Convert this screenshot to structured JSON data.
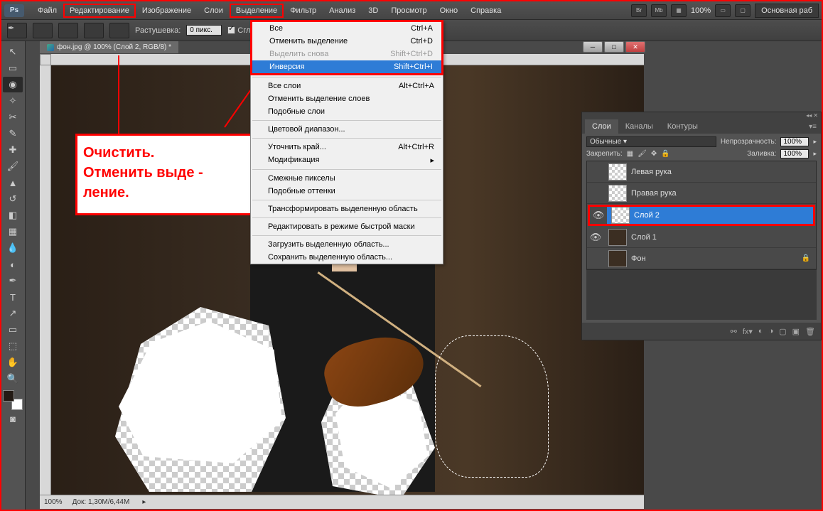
{
  "menubar": {
    "items": [
      "Файл",
      "Редактирование",
      "Изображение",
      "Слои",
      "Выделение",
      "Фильтр",
      "Анализ",
      "3D",
      "Просмотр",
      "Окно",
      "Справка"
    ],
    "zoom": "100%",
    "workspace": "Основная раб"
  },
  "optionsbar": {
    "feather_label": "Растушевка:",
    "feather_value": "0 пикс.",
    "antialias": "Сглаживан"
  },
  "document": {
    "title": "фон.jpg @ 100% (Слой 2, RGB/8) *",
    "status_zoom": "100%",
    "status_doc": "Док: 1,30M/6,44M"
  },
  "annotation": {
    "line1": "Очистить.",
    "line2": "Отменить выде -",
    "line3": "ление."
  },
  "dropdown": {
    "groups": [
      [
        {
          "label": "Все",
          "shortcut": "Ctrl+A",
          "disabled": false
        },
        {
          "label": "Отменить выделение",
          "shortcut": "Ctrl+D",
          "disabled": false
        },
        {
          "label": "Выделить снова",
          "shortcut": "Shift+Ctrl+D",
          "disabled": true
        },
        {
          "label": "Инверсия",
          "shortcut": "Shift+Ctrl+I",
          "disabled": false,
          "selected": true
        }
      ],
      [
        {
          "label": "Все слои",
          "shortcut": "Alt+Ctrl+A",
          "disabled": false
        },
        {
          "label": "Отменить выделение слоев",
          "shortcut": "",
          "disabled": false
        },
        {
          "label": "Подобные слои",
          "shortcut": "",
          "disabled": false
        }
      ],
      [
        {
          "label": "Цветовой диапазон...",
          "shortcut": "",
          "disabled": false
        }
      ],
      [
        {
          "label": "Уточнить край...",
          "shortcut": "Alt+Ctrl+R",
          "disabled": false
        },
        {
          "label": "Модификация",
          "shortcut": "▸",
          "disabled": false
        }
      ],
      [
        {
          "label": "Смежные пикселы",
          "shortcut": "",
          "disabled": false
        },
        {
          "label": "Подобные оттенки",
          "shortcut": "",
          "disabled": false
        }
      ],
      [
        {
          "label": "Трансформировать выделенную область",
          "shortcut": "",
          "disabled": false
        }
      ],
      [
        {
          "label": "Редактировать в режиме быстрой маски",
          "shortcut": "",
          "disabled": false
        }
      ],
      [
        {
          "label": "Загрузить выделенную область...",
          "shortcut": "",
          "disabled": false
        },
        {
          "label": "Сохранить выделенную область...",
          "shortcut": "",
          "disabled": false
        }
      ]
    ]
  },
  "layers_panel": {
    "tabs": [
      "Слои",
      "Каналы",
      "Контуры"
    ],
    "blend_mode": "Обычные",
    "opacity_label": "Непрозрачность:",
    "opacity": "100%",
    "lock_label": "Закрепить:",
    "fill_label": "Заливка:",
    "fill": "100%",
    "layers": [
      {
        "name": "Левая рука",
        "visible": false,
        "thumb": "checker"
      },
      {
        "name": "Правая рука",
        "visible": false,
        "thumb": "checker"
      },
      {
        "name": "Слой 2",
        "visible": true,
        "selected": true,
        "thumb": "checker"
      },
      {
        "name": "Слой 1",
        "visible": true,
        "thumb": "img"
      },
      {
        "name": "Фон",
        "visible": false,
        "thumb": "img",
        "locked": true
      }
    ]
  }
}
